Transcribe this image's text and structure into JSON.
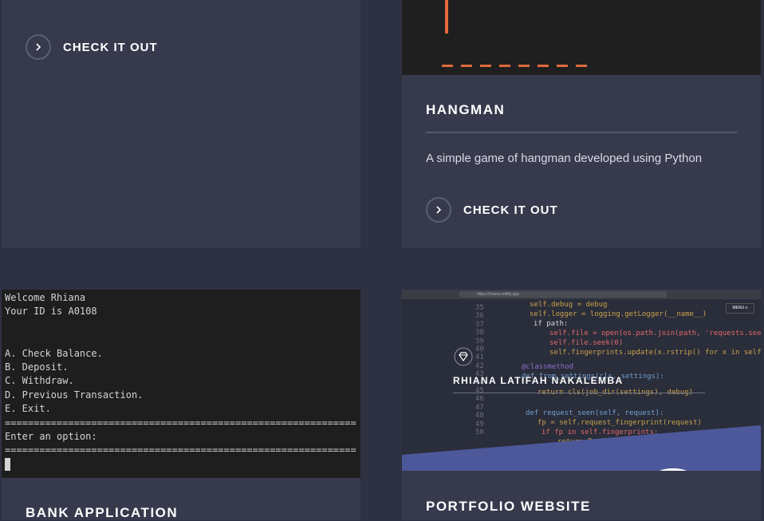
{
  "cards": [
    {
      "cta_label": "CHECK IT OUT"
    },
    {
      "title": "HANGMAN",
      "description": "A simple game of hangman developed using Python",
      "cta_label": "CHECK IT OUT"
    },
    {
      "title": "BANK APPLICATION",
      "terminal": {
        "lines": [
          "Welcome Rhiana",
          "Your ID is A0108",
          "",
          "",
          "A. Check Balance.",
          "B. Deposit.",
          "C. Withdraw.",
          "D. Previous Transaction.",
          "E. Exit.",
          "=============================================================",
          "Enter an option:",
          "============================================================="
        ]
      }
    },
    {
      "title": "PORTFOLIO WEBSITE",
      "screenshot": {
        "url": "https://rhiana.netlify.app",
        "name": "RHIANA LATIFAH NAKALEMBA",
        "menu_label": "MENU ≡",
        "line_numbers": [
          "35",
          "36",
          "37",
          "38",
          "39",
          "40",
          "41",
          "42",
          "43",
          "44",
          "45",
          "46",
          "47",
          "48",
          "49",
          "50"
        ]
      }
    }
  ],
  "colors": {
    "background": "#2e3142",
    "card": "#373a4d",
    "accent_blue": "#4c5899",
    "terminal_bg": "#1e1e1e",
    "hangman_dash": "#e06a3c"
  }
}
